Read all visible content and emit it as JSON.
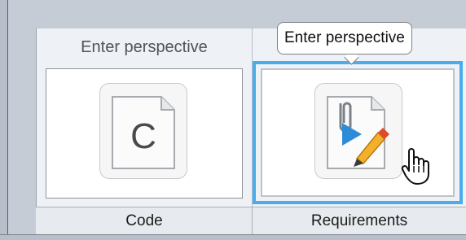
{
  "perspectives": [
    {
      "id": "code",
      "caption": "Code",
      "hover_label": "Enter perspective",
      "icon": "c-source-file-icon",
      "icon_letter": "C"
    },
    {
      "id": "requirements",
      "caption": "Requirements",
      "icon": "requirements-document-icon",
      "selected": true
    }
  ],
  "tooltip": {
    "text": "Enter perspective"
  },
  "cursor": "hand-pointer-icon",
  "colors": {
    "selection_border": "#4aacea",
    "panel_background": "#eef1f5",
    "window_background": "#c6ccd6"
  }
}
